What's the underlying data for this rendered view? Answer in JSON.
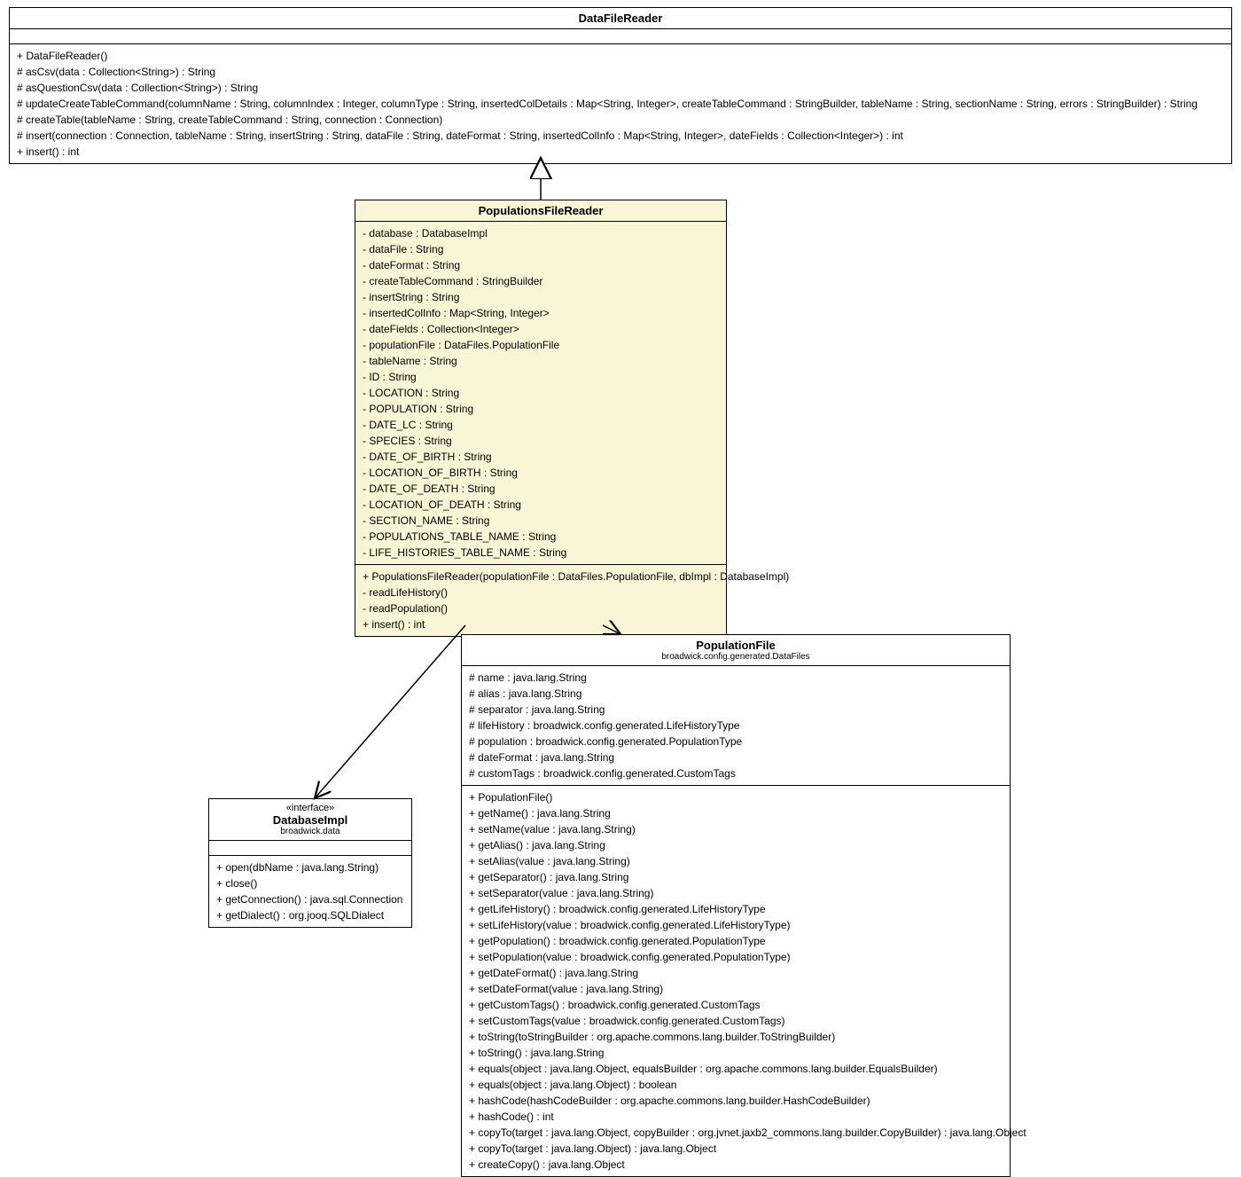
{
  "classes": {
    "dataFileReader": {
      "name": "DataFileReader",
      "attributes": [],
      "operations": [
        "+ DataFileReader()",
        "# asCsv(data : Collection<String>) : String",
        "# asQuestionCsv(data : Collection<String>) : String",
        "# updateCreateTableCommand(columnName : String, columnIndex : Integer, columnType : String, insertedColDetails : Map<String, Integer>, createTableCommand : StringBuilder, tableName : String, sectionName : String, errors : StringBuilder) : String",
        "# createTable(tableName : String, createTableCommand : String, connection : Connection)",
        "# insert(connection : Connection, tableName : String, insertString : String, dataFile : String, dateFormat : String, insertedColInfo : Map<String, Integer>, dateFields : Collection<Integer>) : int",
        "+ insert() : int"
      ]
    },
    "populationsFileReader": {
      "name": "PopulationsFileReader",
      "attributes": [
        "- database : DatabaseImpl",
        "- dataFile : String",
        "- dateFormat : String",
        "- createTableCommand : StringBuilder",
        "- insertString : String",
        "- insertedColInfo : Map<String, Integer>",
        "- dateFields : Collection<Integer>",
        "- populationFile : DataFiles.PopulationFile",
        "- tableName : String",
        "- ID : String",
        "- LOCATION : String",
        "- POPULATION : String",
        "- DATE_LC : String",
        "- SPECIES : String",
        "- DATE_OF_BIRTH : String",
        "- LOCATION_OF_BIRTH : String",
        "- DATE_OF_DEATH : String",
        "- LOCATION_OF_DEATH : String",
        "- SECTION_NAME : String",
        "- POPULATIONS_TABLE_NAME : String",
        "- LIFE_HISTORIES_TABLE_NAME : String"
      ],
      "operations": [
        "+ PopulationsFileReader(populationFile : DataFiles.PopulationFile, dbImpl : DatabaseImpl)",
        "- readLifeHistory()",
        "- readPopulation()",
        "+ insert() : int"
      ]
    },
    "databaseImpl": {
      "stereotype": "«interface»",
      "name": "DatabaseImpl",
      "package": "broadwick.data",
      "attributes": [],
      "operations": [
        "+ open(dbName : java.lang.String)",
        "+ close()",
        "+ getConnection() : java.sql.Connection",
        "+ getDialect() : org.jooq.SQLDialect"
      ]
    },
    "populationFile": {
      "name": "PopulationFile",
      "package": "broadwick.config.generated.DataFiles",
      "attributes": [
        "# name : java.lang.String",
        "# alias : java.lang.String",
        "# separator : java.lang.String",
        "# lifeHistory : broadwick.config.generated.LifeHistoryType",
        "# population : broadwick.config.generated.PopulationType",
        "# dateFormat : java.lang.String",
        "# customTags : broadwick.config.generated.CustomTags"
      ],
      "operations": [
        "+ PopulationFile()",
        "+ getName() : java.lang.String",
        "+ setName(value : java.lang.String)",
        "+ getAlias() : java.lang.String",
        "+ setAlias(value : java.lang.String)",
        "+ getSeparator() : java.lang.String",
        "+ setSeparator(value : java.lang.String)",
        "+ getLifeHistory() : broadwick.config.generated.LifeHistoryType",
        "+ setLifeHistory(value : broadwick.config.generated.LifeHistoryType)",
        "+ getPopulation() : broadwick.config.generated.PopulationType",
        "+ setPopulation(value : broadwick.config.generated.PopulationType)",
        "+ getDateFormat() : java.lang.String",
        "+ setDateFormat(value : java.lang.String)",
        "+ getCustomTags() : broadwick.config.generated.CustomTags",
        "+ setCustomTags(value : broadwick.config.generated.CustomTags)",
        "+ toString(toStringBuilder : org.apache.commons.lang.builder.ToStringBuilder)",
        "+ toString() : java.lang.String",
        "+ equals(object : java.lang.Object, equalsBuilder : org.apache.commons.lang.builder.EqualsBuilder)",
        "+ equals(object : java.lang.Object) : boolean",
        "+ hashCode(hashCodeBuilder : org.apache.commons.lang.builder.HashCodeBuilder)",
        "+ hashCode() : int",
        "+ copyTo(target : java.lang.Object, copyBuilder : org.jvnet.jaxb2_commons.lang.builder.CopyBuilder) : java.lang.Object",
        "+ copyTo(target : java.lang.Object) : java.lang.Object",
        "+ createCopy() : java.lang.Object"
      ]
    }
  }
}
